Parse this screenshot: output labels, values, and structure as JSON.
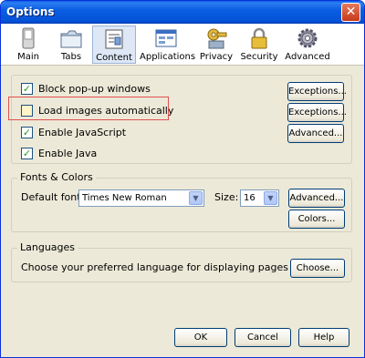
{
  "window": {
    "title": "Options",
    "close_glyph": "✕"
  },
  "toolbar": {
    "tabs": [
      {
        "label": "Main",
        "icon": "switch-icon"
      },
      {
        "label": "Tabs",
        "icon": "folder-tabs-icon"
      },
      {
        "label": "Content",
        "icon": "content-page-icon",
        "selected": true
      },
      {
        "label": "Applications",
        "icon": "applications-window-icon"
      },
      {
        "label": "Privacy",
        "icon": "privacy-key-icon"
      },
      {
        "label": "Security",
        "icon": "padlock-icon"
      },
      {
        "label": "Advanced",
        "icon": "gear-icon"
      }
    ]
  },
  "content": {
    "block_popups": {
      "label": "Block pop-up windows",
      "checked": true
    },
    "load_images": {
      "label": "Load images automatically",
      "checked": false
    },
    "enable_js": {
      "label": "Enable JavaScript",
      "checked": true
    },
    "enable_java": {
      "label": "Enable Java",
      "checked": true
    },
    "exceptions1": "Exceptions...",
    "exceptions2": "Exceptions...",
    "advanced_js": "Advanced...",
    "check_glyph": "✓"
  },
  "fonts": {
    "group_label": "Fonts & Colors",
    "default_font_label": "Default font:",
    "default_font_value": "Times New Roman",
    "size_label": "Size:",
    "size_value": "16",
    "advanced": "Advanced...",
    "colors": "Colors..."
  },
  "languages": {
    "group_label": "Languages",
    "description": "Choose your preferred language for displaying pages",
    "choose": "Choose..."
  },
  "footer": {
    "ok": "OK",
    "cancel": "Cancel",
    "help": "Help"
  },
  "colors": {
    "titlebar": "#0553d8",
    "dialog_bg": "#ece9d8",
    "highlight_box": "#e05050"
  }
}
